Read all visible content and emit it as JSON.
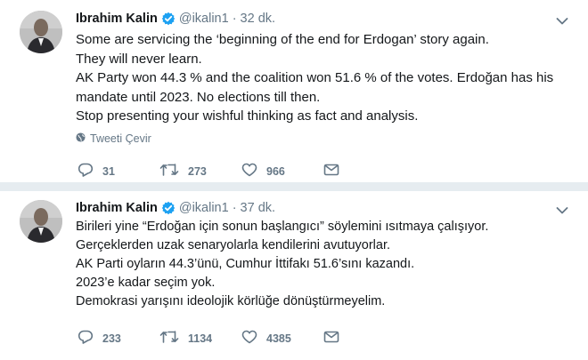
{
  "tweets": [
    {
      "name": "Ibrahim Kalin",
      "handle": "@ikalin1",
      "separator": "·",
      "time": "32 dk.",
      "lines": [
        "Some are servicing the ‘beginning of the end for Erdogan’ story again.",
        "They will never learn.",
        "AK Party won 44.3 % and the coalition won 51.6 % of the votes. Erdoğan has his",
        "mandate until 2023. No elections till then.",
        "Stop presenting your wishful thinking as fact and analysis."
      ],
      "translate_label": "Tweeti Çevir",
      "replies": "31",
      "retweets": "273",
      "likes": "966"
    },
    {
      "name": "Ibrahim Kalin",
      "handle": "@ikalin1",
      "separator": "·",
      "time": "37 dk.",
      "lines": [
        "Birileri yine “Erdoğan için sonun başlangıcı” söylemini ısıtmaya çalışıyor.",
        "Gerçeklerden uzak senaryolarla kendilerini avutuyorlar.",
        "AK Parti oyların 44.3’ünü, Cumhur İttifakı 51.6’sını kazandı.",
        "2023’e kadar seçim yok.",
        "Demokrasi yarışını ideolojik körlüğe dönüştürmeyelim."
      ],
      "replies": "233",
      "retweets": "1134",
      "likes": "4385"
    }
  ],
  "colors": {
    "text": "#14171a",
    "secondary": "#657786",
    "verified": "#1da1f2",
    "divider": "#e6ecf0"
  },
  "icons": [
    "verified-badge-icon",
    "chevron-down-icon",
    "globe-icon",
    "reply-icon",
    "retweet-icon",
    "like-icon",
    "direct-message-icon"
  ]
}
